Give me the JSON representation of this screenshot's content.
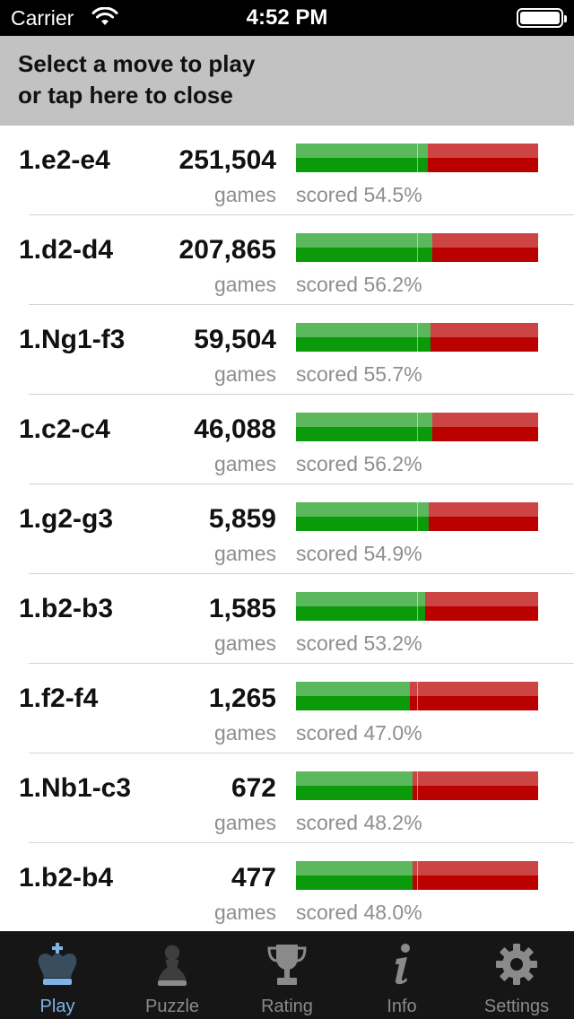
{
  "status_bar": {
    "carrier": "Carrier",
    "time": "4:52 PM"
  },
  "banner": {
    "line1": "Select a move to play",
    "line2": "or tap here to close"
  },
  "colors": {
    "win_light": "#5cb85c",
    "win_dark": "#0a9a0a",
    "loss_light": "#cc4444",
    "loss_dark": "#bb0000",
    "tab_active": "#7fb3e6",
    "tab_inactive": "#8a8a8a"
  },
  "moves": [
    {
      "move": "1.e2-e4",
      "count": "251,504",
      "games_label": "games",
      "scored_label": "scored",
      "score_text": "54.5%",
      "score": 54.5
    },
    {
      "move": "1.d2-d4",
      "count": "207,865",
      "games_label": "games",
      "scored_label": "scored",
      "score_text": "56.2%",
      "score": 56.2
    },
    {
      "move": "1.Ng1-f3",
      "count": "59,504",
      "games_label": "games",
      "scored_label": "scored",
      "score_text": "55.7%",
      "score": 55.7
    },
    {
      "move": "1.c2-c4",
      "count": "46,088",
      "games_label": "games",
      "scored_label": "scored",
      "score_text": "56.2%",
      "score": 56.2
    },
    {
      "move": "1.g2-g3",
      "count": "5,859",
      "games_label": "games",
      "scored_label": "scored",
      "score_text": "54.9%",
      "score": 54.9
    },
    {
      "move": "1.b2-b3",
      "count": "1,585",
      "games_label": "games",
      "scored_label": "scored",
      "score_text": "53.2%",
      "score": 53.2
    },
    {
      "move": "1.f2-f4",
      "count": "1,265",
      "games_label": "games",
      "scored_label": "scored",
      "score_text": "47.0%",
      "score": 47.0
    },
    {
      "move": "1.Nb1-c3",
      "count": "672",
      "games_label": "games",
      "scored_label": "scored",
      "score_text": "48.2%",
      "score": 48.2
    },
    {
      "move": "1.b2-b4",
      "count": "477",
      "games_label": "games",
      "scored_label": "scored",
      "score_text": "48.0%",
      "score": 48.0
    }
  ],
  "tabs": [
    {
      "label": "Play",
      "icon": "king-crown-icon",
      "active": true
    },
    {
      "label": "Puzzle",
      "icon": "pawn-icon",
      "active": false
    },
    {
      "label": "Rating",
      "icon": "trophy-icon",
      "active": false
    },
    {
      "label": "Info",
      "icon": "info-icon",
      "active": false
    },
    {
      "label": "Settings",
      "icon": "gear-icon",
      "active": false
    }
  ]
}
